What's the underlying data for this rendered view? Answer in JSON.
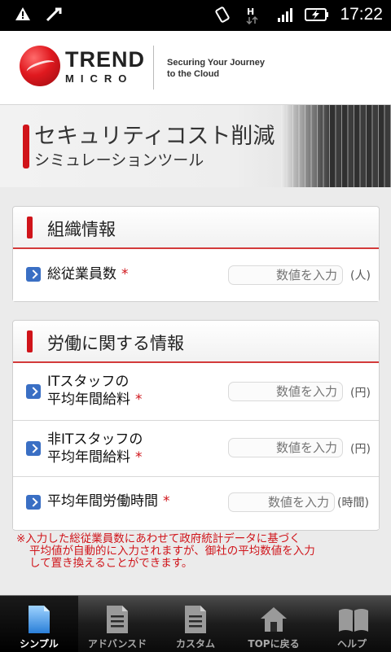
{
  "status_bar": {
    "time": "17:22"
  },
  "header": {
    "logo_trend": "TREND",
    "logo_micro": "MICRO",
    "tagline_1": "Securing Your Journey",
    "tagline_2": "to the Cloud"
  },
  "banner": {
    "title": "セキュリティコスト削減",
    "subtitle": "シミュレーションツール"
  },
  "required_mark": "*",
  "sections": [
    {
      "title": "組織情報",
      "rows": [
        {
          "label_1": "総従業員数",
          "label_2": "",
          "placeholder": "数値を入力",
          "unit": "(人)"
        }
      ]
    },
    {
      "title": "労働に関する情報",
      "rows": [
        {
          "label_1": "ITスタッフの",
          "label_2": "平均年間給料",
          "placeholder": "数値を入力",
          "unit": "(円)"
        },
        {
          "label_1": "非ITスタッフの",
          "label_2": "平均年間給料",
          "placeholder": "数値を入力",
          "unit": "(円)"
        },
        {
          "label_1": "平均年間労働時間",
          "label_2": "",
          "placeholder": "数値を入力",
          "unit": "(時間)"
        }
      ]
    }
  ],
  "note": {
    "line_1": "※入力した総従業員数にあわせて政府統計データに基づく",
    "line_2": "平均値が自動的に入力されますが、御社の平均数値を入力",
    "line_3": "して置き換えることができます。"
  },
  "bottom_nav": [
    {
      "label": "シンプル",
      "icon": "document-icon",
      "active": true
    },
    {
      "label": "アドバンスド",
      "icon": "document-lines-icon",
      "active": false
    },
    {
      "label": "カスタム",
      "icon": "document-lines-icon",
      "active": false
    },
    {
      "label": "TOPに戻る",
      "icon": "home-icon",
      "active": false
    },
    {
      "label": "ヘルプ",
      "icon": "book-icon",
      "active": false
    }
  ],
  "colors": {
    "accent_red": "#d0141a",
    "arrow_blue": "#3a6fc4",
    "nav_dark": "#1c1c1c"
  }
}
